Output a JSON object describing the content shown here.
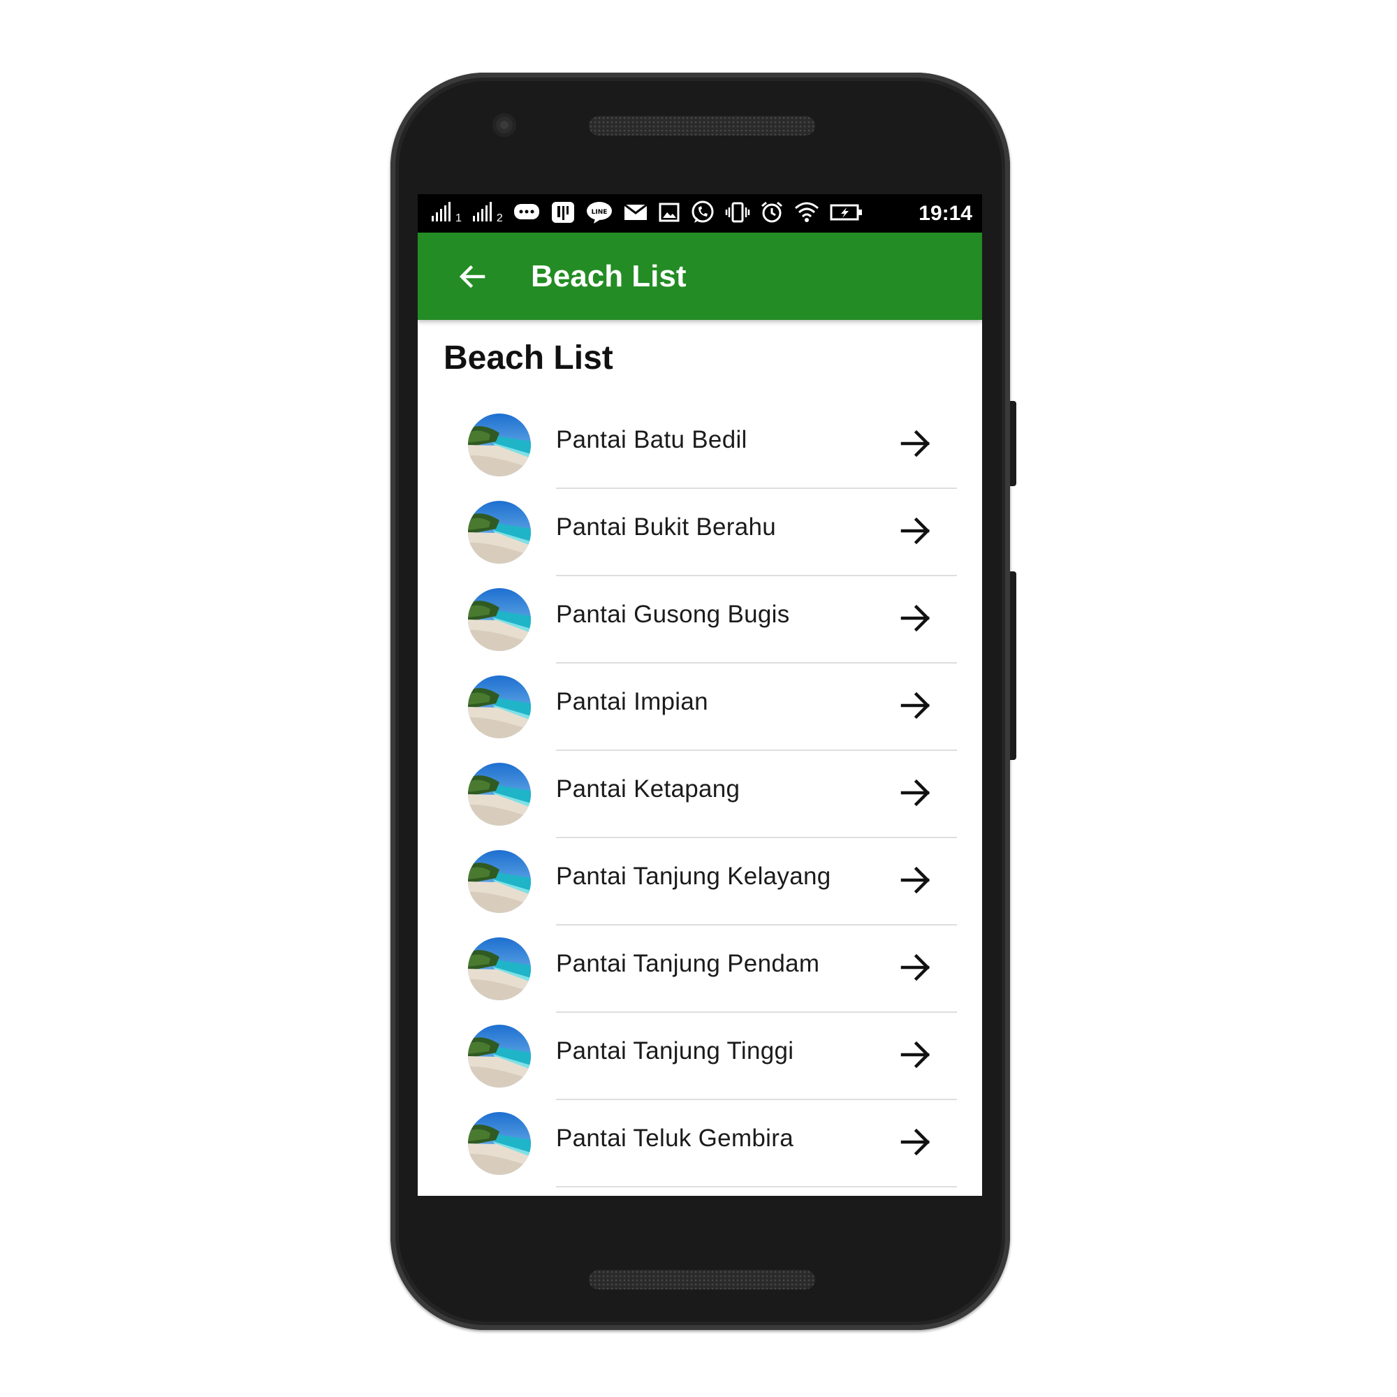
{
  "status_bar": {
    "time": "19:14",
    "sim1_label": "1",
    "sim2_label": "2",
    "icons": [
      "signal-icon",
      "signal-icon",
      "message-icon",
      "app-notification-icon",
      "line-icon",
      "email-icon",
      "image-icon",
      "whatsapp-icon",
      "vibrate-icon",
      "alarm-icon",
      "wifi-icon",
      "battery-charging-icon"
    ]
  },
  "app_bar": {
    "title": "Beach List",
    "back_icon": "arrow-back-icon",
    "color": "#238c24"
  },
  "page": {
    "heading": "Beach List"
  },
  "beaches": [
    {
      "name": "Pantai Batu Bedil"
    },
    {
      "name": "Pantai Bukit Berahu"
    },
    {
      "name": "Pantai Gusong Bugis"
    },
    {
      "name": "Pantai Impian"
    },
    {
      "name": "Pantai Ketapang"
    },
    {
      "name": "Pantai Tanjung Kelayang"
    },
    {
      "name": "Pantai Tanjung Pendam"
    },
    {
      "name": "Pantai Tanjung Tinggi"
    },
    {
      "name": "Pantai Teluk Gembira"
    }
  ]
}
